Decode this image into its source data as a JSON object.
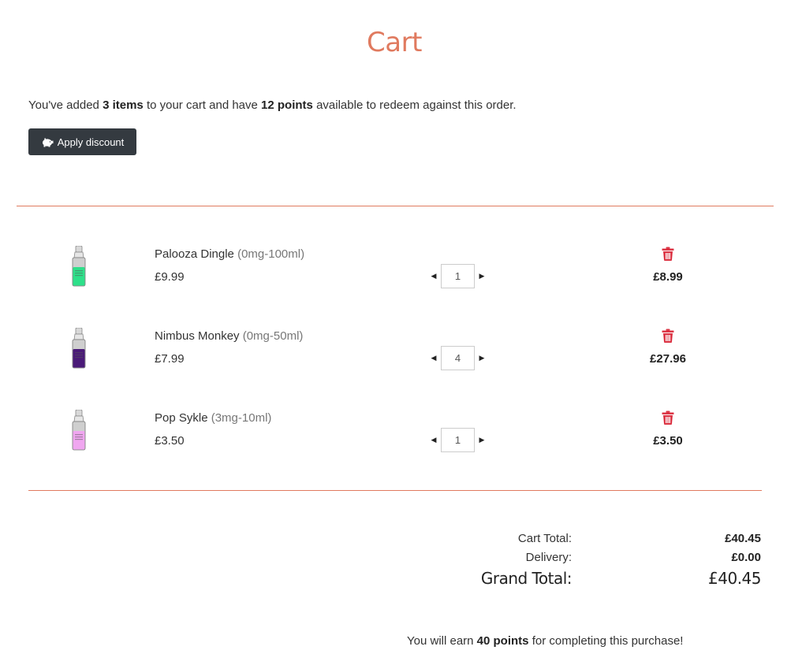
{
  "page": {
    "title": "Cart"
  },
  "intro": {
    "prefix": "You've added ",
    "items_count": "3 items",
    "middle": " to your cart and have ",
    "points": "12 points",
    "suffix": " available to redeem against this order."
  },
  "apply_button": {
    "label": "Apply discount",
    "icon": "piggy-bank-icon"
  },
  "cart_items": [
    {
      "name": "Palooza Dingle",
      "variant": "(0mg-100ml)",
      "price": "£9.99",
      "quantity": "1",
      "subtotal": "£8.99",
      "bottle_color": "#2ee08a"
    },
    {
      "name": "Nimbus Monkey",
      "variant": "(0mg-50ml)",
      "price": "£7.99",
      "quantity": "4",
      "subtotal": "£27.96",
      "bottle_color": "#4a1a78"
    },
    {
      "name": "Pop Sykle",
      "variant": "(3mg-10ml)",
      "price": "£3.50",
      "quantity": "1",
      "subtotal": "£3.50",
      "bottle_color": "#f0a6f0"
    }
  ],
  "totals": {
    "cart_total_label": "Cart Total:",
    "cart_total": "£40.45",
    "delivery_label": "Delivery:",
    "delivery": "£0.00",
    "grand_total_label": "Grand Total:",
    "grand_total": "£40.45"
  },
  "earn": {
    "prefix": "You will earn ",
    "points": "40 points",
    "suffix": " for completing this purchase!"
  },
  "colors": {
    "accent": "#e07a5f",
    "button_bg": "#343a40",
    "delete": "#dc3545"
  }
}
